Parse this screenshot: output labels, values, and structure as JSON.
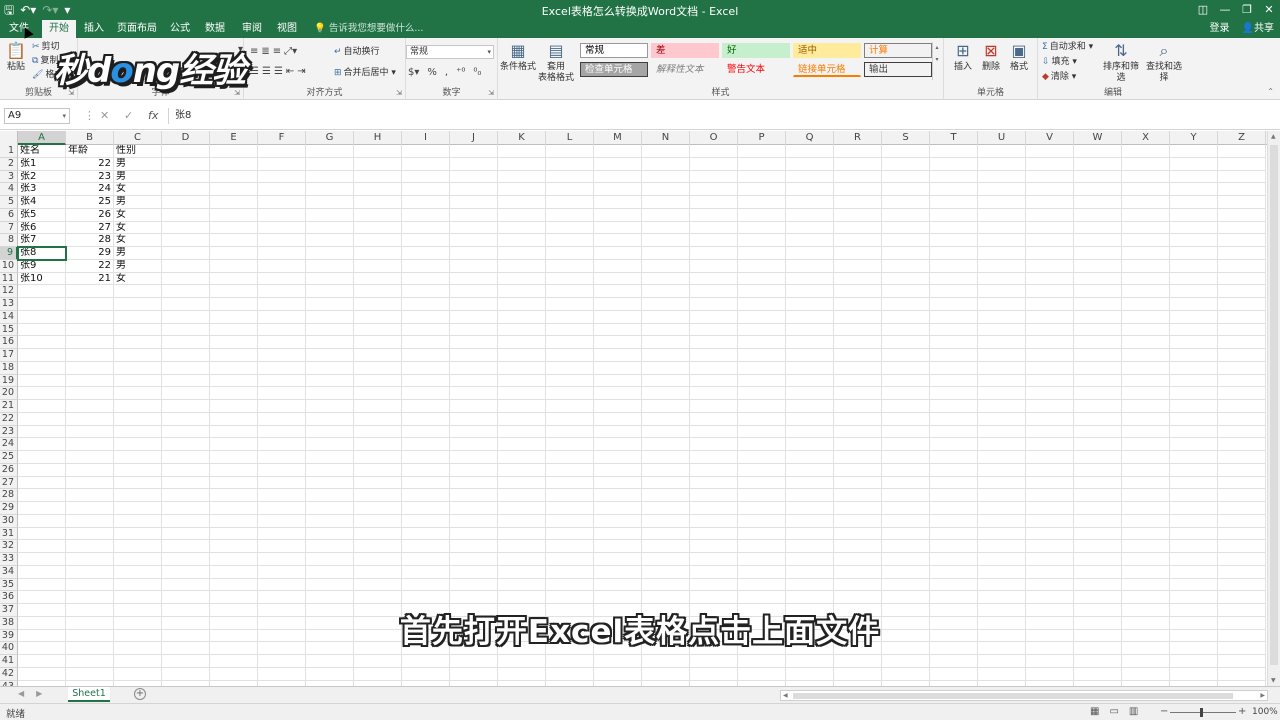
{
  "window": {
    "title": "Excel表格怎么转换成Word文档 - Excel",
    "qat": {
      "save_icon": "save-icon",
      "undo_icon": "undo-icon",
      "redo_icon": "redo-icon",
      "customize_icon": "customize-qat-icon"
    },
    "controls": {
      "ribbon_display": "◫",
      "minimize": "—",
      "restore": "❐",
      "close": "✕"
    }
  },
  "tabs": [
    {
      "label": "文件"
    },
    {
      "label": "开始"
    },
    {
      "label": "插入"
    },
    {
      "label": "页面布局"
    },
    {
      "label": "公式"
    },
    {
      "label": "数据"
    },
    {
      "label": "审阅"
    },
    {
      "label": "视图"
    }
  ],
  "tellme": "告诉我您想要做什么...",
  "account": {
    "login": "登录",
    "share": "共享"
  },
  "watermark": {
    "part1": "秒d",
    "part2": "o",
    "part3": "ng经验"
  },
  "ribbon": {
    "clipboard": {
      "label": "剪贴板",
      "paste": "粘贴",
      "cut": "剪切",
      "copy": "复制",
      "format_painter": "格式刷"
    },
    "font": {
      "label": "字体"
    },
    "alignment": {
      "label": "对齐方式",
      "wrap": "自动换行",
      "merge": "合并后居中"
    },
    "number": {
      "label": "数字",
      "format": "常规"
    },
    "styles": {
      "label": "样式",
      "conditional": "条件格式",
      "as_table_1": "套用",
      "as_table_2": "表格格式",
      "gallery": [
        {
          "text": "常规",
          "bg": "#ffffff",
          "fg": "#000000",
          "border": "#999999"
        },
        {
          "text": "差",
          "bg": "#ffc7ce",
          "fg": "#9c0006",
          "border": "transparent"
        },
        {
          "text": "好",
          "bg": "#c6efce",
          "fg": "#006100",
          "border": "transparent"
        },
        {
          "text": "适中",
          "bg": "#ffeb9c",
          "fg": "#9c5700",
          "border": "transparent"
        },
        {
          "text": "计算",
          "bg": "#f2f2f2",
          "fg": "#fa7d00",
          "border": "#7f7f7f"
        },
        {
          "text": "检查单元格",
          "bg": "#a5a5a5",
          "fg": "#ffffff",
          "border": "#3f3f3f"
        },
        {
          "text": "解释性文本",
          "bg": "transparent",
          "fg": "#7f7f7f",
          "border": "transparent"
        },
        {
          "text": "警告文本",
          "bg": "transparent",
          "fg": "#ff0000",
          "border": "transparent"
        },
        {
          "text": "链接单元格",
          "bg": "transparent",
          "fg": "#fa7d00",
          "border": "transparent"
        },
        {
          "text": "输出",
          "bg": "#f2f2f2",
          "fg": "#3f3f3f",
          "border": "#3f3f3f"
        }
      ]
    },
    "cells": {
      "label": "单元格",
      "insert": "插入",
      "delete": "删除",
      "format": "格式"
    },
    "editing": {
      "label": "编辑",
      "autosum": "自动求和",
      "fill": "填充",
      "clear": "清除",
      "sort": "排序和筛选",
      "find": "查找和选择"
    }
  },
  "formula_bar": {
    "name_box": "A9",
    "cancel": "✕",
    "enter": "✓",
    "fx": "fx",
    "content": "张8"
  },
  "grid": {
    "columns": [
      "A",
      "B",
      "C",
      "D",
      "E",
      "F",
      "G",
      "H",
      "I",
      "J",
      "K",
      "L",
      "M",
      "N",
      "O",
      "P",
      "Q",
      "R",
      "S",
      "T",
      "U",
      "V",
      "W",
      "X",
      "Y",
      "Z"
    ],
    "selected_column": "A",
    "selected_row": 9,
    "row_count": 43,
    "data": [
      [
        "姓名",
        "年龄",
        "性别"
      ],
      [
        "张1",
        "22",
        "男"
      ],
      [
        "张2",
        "23",
        "男"
      ],
      [
        "张3",
        "24",
        "女"
      ],
      [
        "张4",
        "25",
        "男"
      ],
      [
        "张5",
        "26",
        "女"
      ],
      [
        "张6",
        "27",
        "女"
      ],
      [
        "张7",
        "28",
        "女"
      ],
      [
        "张8",
        "29",
        "男"
      ],
      [
        "张9",
        "22",
        "男"
      ],
      [
        "张10",
        "21",
        "女"
      ]
    ]
  },
  "sheets": [
    {
      "name": "Sheet1"
    }
  ],
  "status": {
    "ready": "就绪",
    "zoom": "100%"
  },
  "subtitle": "首先打开Excel表格点击上面文件",
  "colors": {
    "accent": "#217346"
  }
}
